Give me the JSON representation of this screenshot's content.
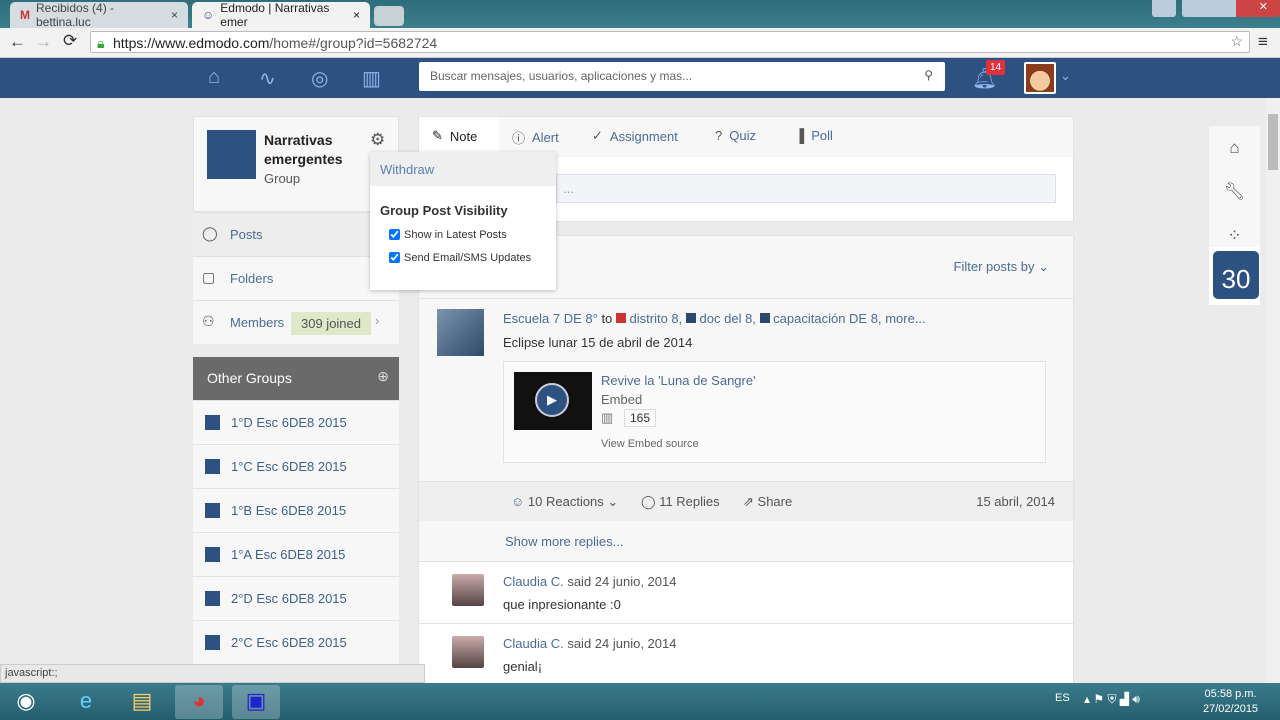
{
  "browser": {
    "tabs": [
      {
        "label": "Recibidos (4) - bettina.luc",
        "icon": "gmail-icon"
      },
      {
        "label": "Edmodo | Narrativas emer",
        "icon": "edmodo-icon"
      }
    ],
    "url_host": "https://www.edmodo.com",
    "url_path": "/home#/group?id=5682724",
    "status": "javascript:;"
  },
  "nav": {
    "search_placeholder": "Buscar mensajes, usuarios, aplicaciones y mas...",
    "notifications": "14"
  },
  "group": {
    "name": "Narrativas emergentes",
    "type": "Group",
    "posts": "Posts",
    "folders": "Folders",
    "members": "Members",
    "joined": "309 joined"
  },
  "dropdown": {
    "withdraw": "Withdraw",
    "title": "Group Post Visibility",
    "opt1": "Show in Latest Posts",
    "opt2": "Send Email/SMS Updates"
  },
  "other_groups": {
    "title": "Other Groups",
    "items": [
      "1°D Esc 6DE8 2015",
      "1°C Esc 6DE8 2015",
      "1°B Esc 6DE8 2015",
      "1°A Esc 6DE8 2015",
      "2°D Esc 6DE8 2015",
      "2°C Esc 6DE8 2015"
    ]
  },
  "composer": {
    "tabs": [
      "Note",
      "Alert",
      "Assignment",
      "Quiz",
      "Poll"
    ],
    "placeholder": "..."
  },
  "feed": {
    "filter": "Filter posts by",
    "post": {
      "author": "Escuela 7 DE 8°",
      "to": "to",
      "recipients": [
        "distrito 8,",
        "doc del 8,",
        "capacitación DE 8,"
      ],
      "more": "more...",
      "text": "Eclipse lunar 15 de abril de 2014",
      "embed": {
        "title": "Revive la 'Luna de Sangre'",
        "type": "Embed",
        "count": "165",
        "source": "View Embed source"
      },
      "reactions": "10 Reactions",
      "replies": "11 Replies",
      "share": "Share",
      "date": "15 abril, 2014",
      "show_more": "Show more replies..."
    },
    "comments": [
      {
        "author": "Claudia C.",
        "said": "said 24 junio, 2014",
        "text": "que inpresionante :0"
      },
      {
        "author": "Claudia C.",
        "said": "said 24 junio, 2014",
        "text": "genial¡"
      }
    ]
  },
  "rail": {
    "calendar_day": "30"
  },
  "taskbar": {
    "lang": "ES",
    "time": "05:58 p.m.",
    "date": "27/02/2015"
  }
}
